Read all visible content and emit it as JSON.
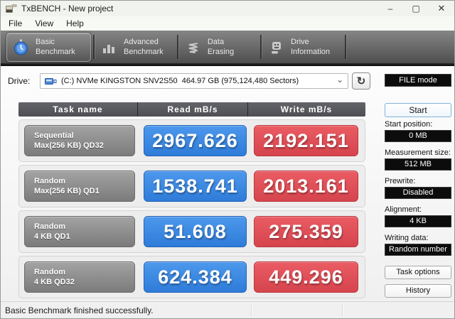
{
  "window": {
    "title": "TxBENCH - New project"
  },
  "icons": {
    "minimize": "–",
    "maximize": "▢",
    "close": "✕",
    "chevron_down": "⌄",
    "refresh": "↻"
  },
  "menu": {
    "items": [
      "File",
      "View",
      "Help"
    ]
  },
  "tabs": [
    {
      "line1": "Basic",
      "line2": "Benchmark",
      "icon": "stopwatch-icon",
      "active": true
    },
    {
      "line1": "Advanced",
      "line2": "Benchmark",
      "icon": "bar-chart-icon",
      "active": false
    },
    {
      "line1": "Data Erasing",
      "line2": "",
      "icon": "erase-icon",
      "active": false
    },
    {
      "line1": "Drive",
      "line2": "Information",
      "icon": "drive-icon",
      "active": false
    }
  ],
  "drive": {
    "label": "Drive:",
    "value": "(C:) NVMe KINGSTON SNV2S50  464.97 GB (975,124,480 Sectors)"
  },
  "mode": {
    "label": "FILE mode"
  },
  "table": {
    "headers": {
      "task": "Task name",
      "read": "Read mB/s",
      "write": "Write mB/s"
    },
    "rows": [
      {
        "task_line1": "Sequential",
        "task_line2": "Max(256 KB) QD32",
        "read": "2967.626",
        "write": "2192.151"
      },
      {
        "task_line1": "Random",
        "task_line2": "Max(256 KB) QD1",
        "read": "1538.741",
        "write": "2013.161"
      },
      {
        "task_line1": "Random",
        "task_line2": "4 KB QD1",
        "read": "51.608",
        "write": "275.359"
      },
      {
        "task_line1": "Random",
        "task_line2": "4 KB QD32",
        "read": "624.384",
        "write": "449.296"
      }
    ]
  },
  "sidebar": {
    "start_button": "Start",
    "fields": [
      {
        "label": "Start position:",
        "value": "0 MB"
      },
      {
        "label": "Measurement size:",
        "value": "512 MB"
      },
      {
        "label": "Prewrite:",
        "value": "Disabled"
      },
      {
        "label": "Alignment:",
        "value": "4 KB"
      },
      {
        "label": "Writing data:",
        "value": "Random number"
      }
    ],
    "task_options_button": "Task options",
    "history_button": "History"
  },
  "status": {
    "message": "Basic Benchmark finished successfully."
  },
  "colors": {
    "read_blue": "#2e7cd9",
    "write_red": "#d6444d",
    "value_black": "#0c0c0c",
    "tabbar_gray": "#4a4a4a"
  }
}
